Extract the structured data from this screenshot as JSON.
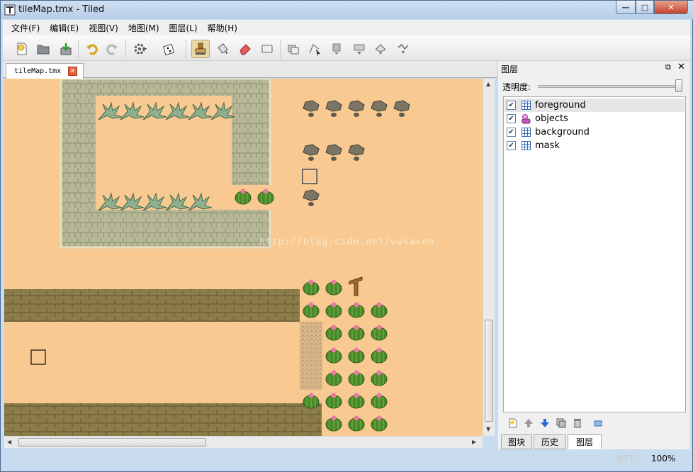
{
  "window": {
    "title": "tileMap.tmx - Tiled"
  },
  "menubar": {
    "items": [
      "文件(F)",
      "编辑(E)",
      "视图(V)",
      "地图(M)",
      "图层(L)",
      "帮助(H)"
    ]
  },
  "toolbar": {
    "buttons": [
      "new-file-icon",
      "open-folder-icon",
      "save-icon",
      "undo-icon",
      "redo-icon",
      "settings-icon",
      "random-dice-icon",
      "stamp-brush-icon",
      "bucket-fill-icon",
      "eraser-icon",
      "rect-select-icon",
      "select-objects-icon",
      "edit-polygon-icon",
      "insert-object-icon",
      "insert-tile-icon",
      "insert-polygon-icon",
      "insert-polyline-icon"
    ],
    "active": "stamp-brush-icon"
  },
  "editor": {
    "tab_label": "tileMap.tmx",
    "watermark": "http://blog.csdn.net/wwkaven"
  },
  "colors": {
    "sand": "#f8c990",
    "stone": "#b7b898",
    "wall": "#8b7c4a",
    "cactus": "#4a8a2a",
    "flower": "#e87aa0",
    "rock": "#7b7566",
    "accent_selected": "#e8d9a8"
  },
  "layers_panel": {
    "title": "图层",
    "opacity_label": "透明度:",
    "opacity": 1.0,
    "layers": [
      {
        "name": "foreground",
        "visible": true,
        "type": "tile-layer-icon",
        "selected": true
      },
      {
        "name": "objects",
        "visible": true,
        "type": "object-layer-icon",
        "selected": false
      },
      {
        "name": "background",
        "visible": true,
        "type": "tile-layer-icon",
        "selected": false
      },
      {
        "name": "mask",
        "visible": true,
        "type": "tile-layer-icon",
        "selected": false
      }
    ],
    "tools": [
      "new-layer-icon",
      "move-up-icon",
      "move-down-icon",
      "duplicate-layer-icon",
      "delete-layer-icon",
      "show-hide-icon"
    ],
    "tabs": [
      "图块",
      "历史",
      "图层"
    ],
    "active_tab": "图层"
  },
  "status": {
    "zoom": "100%",
    "corner_text": "@51C"
  }
}
